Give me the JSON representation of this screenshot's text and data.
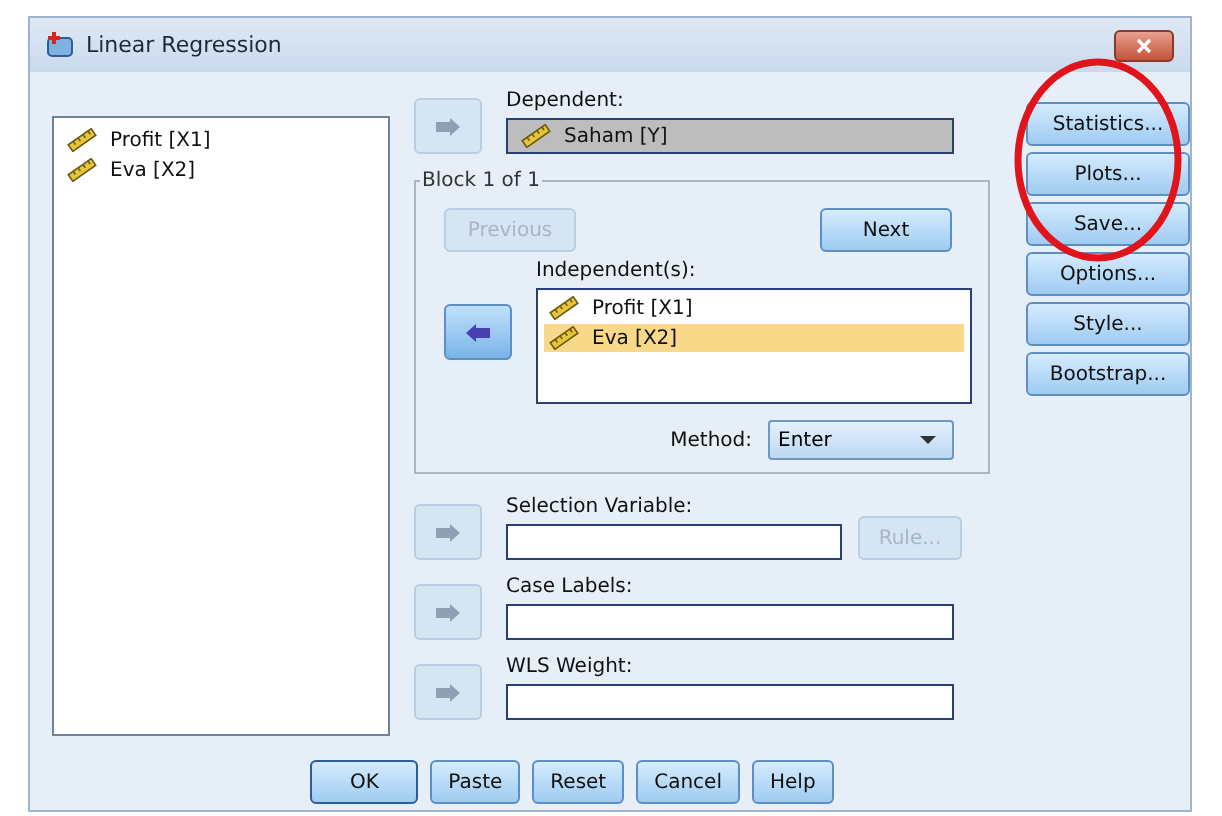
{
  "window": {
    "title": "Linear Regression"
  },
  "variables": [
    {
      "label": "Profit [X1]",
      "selected": false
    },
    {
      "label": "Eva [X2]",
      "selected": false
    }
  ],
  "dependent": {
    "label": "Dependent:",
    "value": "Saham [Y]",
    "arrow_disabled": true
  },
  "block": {
    "legend": "Block 1 of 1",
    "previous": {
      "label": "Previous",
      "disabled": true
    },
    "next": {
      "label": "Next",
      "disabled": false
    },
    "independents_label": "Independent(s):",
    "arrow_disabled": false,
    "independents": [
      {
        "label": "Profit [X1]",
        "selected": false
      },
      {
        "label": "Eva [X2]",
        "selected": true
      }
    ],
    "method_label": "Method:",
    "method": "Enter"
  },
  "selection": {
    "label": "Selection Variable:",
    "arrow_disabled": true,
    "rule": {
      "label": "Rule...",
      "disabled": true
    }
  },
  "case_labels": {
    "label": "Case Labels:",
    "arrow_disabled": true
  },
  "wls": {
    "label": "WLS Weight:",
    "arrow_disabled": true
  },
  "side_buttons": [
    "Statistics...",
    "Plots...",
    "Save...",
    "Options...",
    "Style...",
    "Bootstrap..."
  ],
  "bottom_buttons": [
    {
      "label": "OK",
      "default": true
    },
    {
      "label": "Paste",
      "default": false
    },
    {
      "label": "Reset",
      "default": false
    },
    {
      "label": "Cancel",
      "default": false
    },
    {
      "label": "Help",
      "default": false
    }
  ]
}
